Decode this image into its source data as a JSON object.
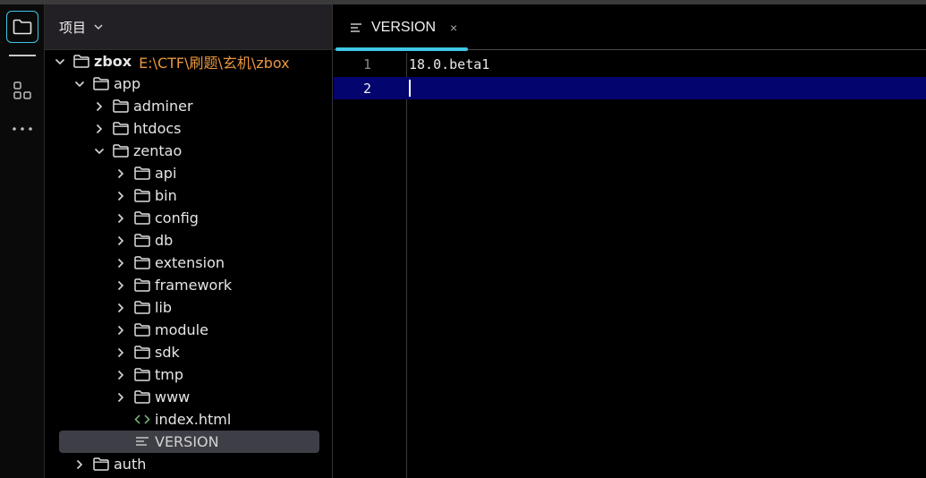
{
  "colors": {
    "accent": "#3fc7e6",
    "path_orange": "#e9963f",
    "current_line": "#04046e",
    "selection": "#3e3e46",
    "html_icon_green": "#79c07a"
  },
  "activity_bar": {
    "items": [
      {
        "icon": "folder-icon",
        "active": true
      },
      {
        "icon": "structure-icon",
        "active": false
      },
      {
        "icon": "more-icon",
        "active": false
      }
    ]
  },
  "project_panel": {
    "title": "项目",
    "tree": [
      {
        "label": "zbox",
        "path": "E:\\CTF\\刷题\\玄机\\zbox",
        "type": "folder",
        "expanded": true,
        "depth": 0
      },
      {
        "label": "app",
        "type": "folder",
        "expanded": true,
        "depth": 1
      },
      {
        "label": "adminer",
        "type": "folder",
        "expanded": false,
        "depth": 2
      },
      {
        "label": "htdocs",
        "type": "folder",
        "expanded": false,
        "depth": 2
      },
      {
        "label": "zentao",
        "type": "folder",
        "expanded": true,
        "depth": 2
      },
      {
        "label": "api",
        "type": "folder",
        "expanded": false,
        "depth": 3
      },
      {
        "label": "bin",
        "type": "folder",
        "expanded": false,
        "depth": 3
      },
      {
        "label": "config",
        "type": "folder",
        "expanded": false,
        "depth": 3
      },
      {
        "label": "db",
        "type": "folder",
        "expanded": false,
        "depth": 3
      },
      {
        "label": "extension",
        "type": "folder",
        "expanded": false,
        "depth": 3
      },
      {
        "label": "framework",
        "type": "folder",
        "expanded": false,
        "depth": 3
      },
      {
        "label": "lib",
        "type": "folder",
        "expanded": false,
        "depth": 3
      },
      {
        "label": "module",
        "type": "folder",
        "expanded": false,
        "depth": 3
      },
      {
        "label": "sdk",
        "type": "folder",
        "expanded": false,
        "depth": 3
      },
      {
        "label": "tmp",
        "type": "folder",
        "expanded": false,
        "depth": 3
      },
      {
        "label": "www",
        "type": "folder",
        "expanded": false,
        "depth": 3
      },
      {
        "label": "index.html",
        "type": "html-file",
        "depth": 3
      },
      {
        "label": "VERSION",
        "type": "text-file",
        "depth": 3,
        "selected": true
      },
      {
        "label": "auth",
        "type": "folder",
        "expanded": false,
        "depth": 1
      }
    ]
  },
  "editor": {
    "tab": {
      "label": "VERSION",
      "close": "×"
    },
    "lines": [
      {
        "number": "1",
        "text": "18.0.beta1",
        "current": false
      },
      {
        "number": "2",
        "text": "",
        "current": true
      }
    ]
  }
}
